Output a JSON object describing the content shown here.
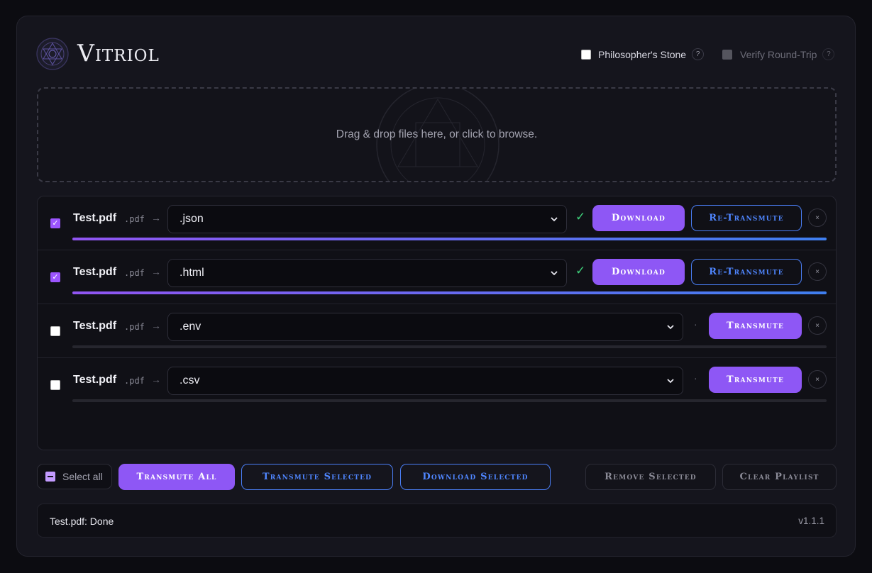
{
  "app": {
    "title": "Vitriol"
  },
  "options": [
    {
      "label": "Philosopher's Stone",
      "help": "?",
      "checked": false,
      "enabled": true
    },
    {
      "label": "Verify Round-Trip",
      "help": "?",
      "checked": false,
      "enabled": false
    }
  ],
  "dropzone": {
    "text": "Drag & drop files here, or click to browse."
  },
  "files": [
    {
      "name": "Test.pdf",
      "source_ext": ".pdf",
      "arrow": "→",
      "target": ".json",
      "selected": true,
      "done": true,
      "status_mark": "✓",
      "actions": [
        "Download",
        "Re-Transmute"
      ],
      "progress": 1.0,
      "remove": "×"
    },
    {
      "name": "Test.pdf",
      "source_ext": ".pdf",
      "arrow": "→",
      "target": ".html",
      "selected": true,
      "done": true,
      "status_mark": "✓",
      "actions": [
        "Download",
        "Re-Transmute"
      ],
      "progress": 1.0,
      "remove": "×"
    },
    {
      "name": "Test.pdf",
      "source_ext": ".pdf",
      "arrow": "→",
      "target": ".env",
      "selected": false,
      "done": false,
      "status_mark": "·",
      "actions": [
        "Transmute"
      ],
      "progress": 0.0,
      "remove": "×"
    },
    {
      "name": "Test.pdf",
      "source_ext": ".pdf",
      "arrow": "→",
      "target": ".csv",
      "selected": false,
      "done": false,
      "status_mark": "·",
      "actions": [
        "Transmute"
      ],
      "progress": 0.0,
      "remove": "×"
    }
  ],
  "toolbar": {
    "select_all": "Select all",
    "transmute_all": "Transmute All",
    "transmute_selected": "Transmute Selected",
    "download_selected": "Download Selected",
    "remove_selected": "Remove Selected",
    "clear_playlist": "Clear Playlist"
  },
  "status": {
    "message": "Test.pdf: Done",
    "version": "v1.1.1"
  },
  "colors": {
    "accent": "#8e57f5",
    "outline_blue": "#4f86ff",
    "success": "#3ed07a",
    "background": "#15151d"
  }
}
